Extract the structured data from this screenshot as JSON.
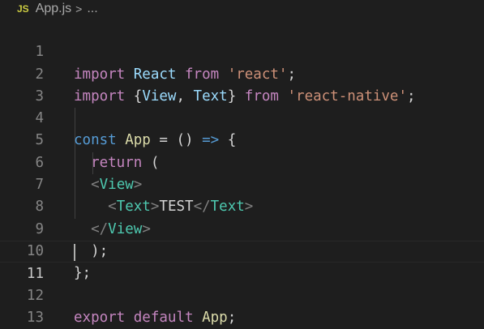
{
  "breadcrumb": {
    "icon": "JS",
    "file": "App.js",
    "separator": ">",
    "more": "..."
  },
  "lines": [
    {
      "n": "1"
    },
    {
      "n": "2"
    },
    {
      "n": "3"
    },
    {
      "n": "4"
    },
    {
      "n": "5"
    },
    {
      "n": "6"
    },
    {
      "n": "7"
    },
    {
      "n": "8"
    },
    {
      "n": "9"
    },
    {
      "n": "10"
    },
    {
      "n": "11"
    },
    {
      "n": "12"
    },
    {
      "n": "13"
    }
  ],
  "code": {
    "l1": {
      "import": "import",
      "react_id": "React",
      "from": "from",
      "str": "'react'",
      "semi": ";"
    },
    "l2": {
      "import": "import",
      "open": "{",
      "view": "View",
      "comma": ", ",
      "text": "Text",
      "close": "}",
      "from": "from",
      "str": "'react-native'",
      "semi": ";"
    },
    "l4": {
      "const": "const",
      "app": "App",
      "eq": " = ",
      "paren": "()",
      "arrow": " => ",
      "brace": "{"
    },
    "l5": {
      "return": "return",
      "paren": "("
    },
    "l6": {
      "lt": "<",
      "tag": "View",
      "gt": ">"
    },
    "l7": {
      "lt": "<",
      "tag": "Text",
      "gt": ">",
      "content": "TEST",
      "lt2": "</",
      "tag2": "Text",
      "gt2": ">"
    },
    "l8": {
      "lt": "</",
      "tag": "View",
      "gt": ">"
    },
    "l9": {
      "paren": ")",
      "semi": ";"
    },
    "l10": {
      "brace": "}",
      "semi": ";"
    },
    "l12": {
      "export": "export",
      "default": "default",
      "app": "App",
      "semi": ";"
    }
  },
  "colors": {
    "background": "#1e1e1e",
    "keyword_control": "#c586c0",
    "keyword": "#569cd6",
    "function": "#dcdcaa",
    "variable": "#9cdcfe",
    "string": "#ce9178",
    "jsx_tag": "#4ec9b0"
  }
}
